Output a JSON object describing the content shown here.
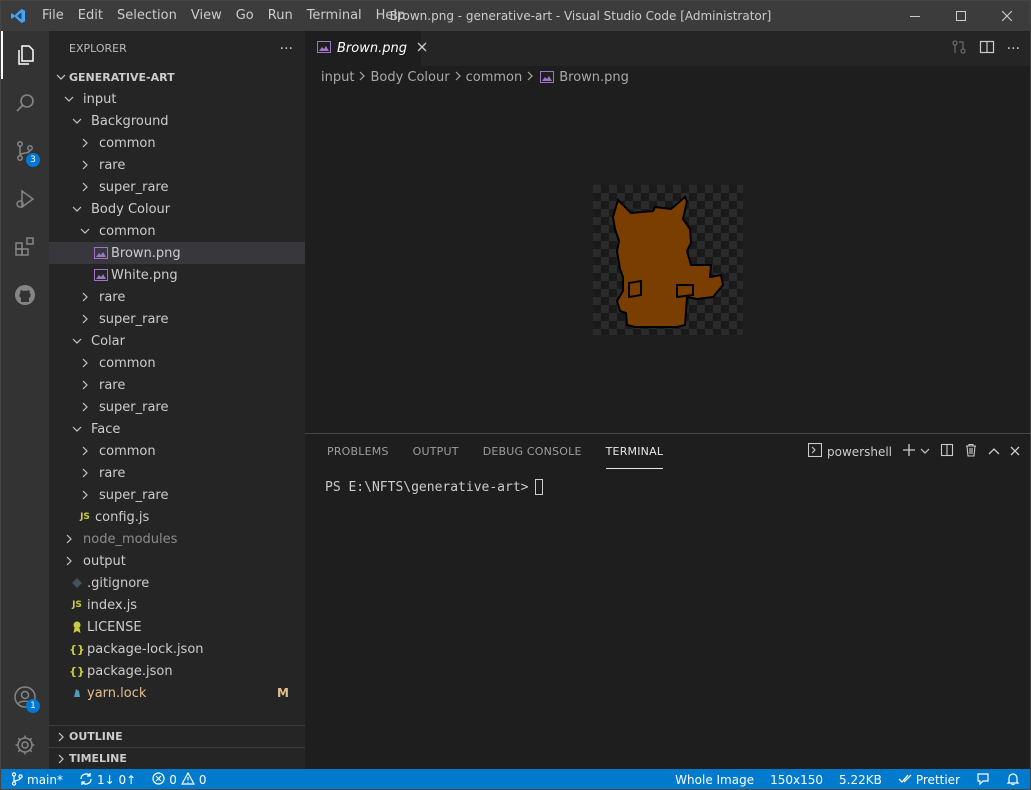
{
  "window": {
    "title": "Brown.png - generative-art - Visual Studio Code [Administrator]",
    "menu": [
      "File",
      "Edit",
      "Selection",
      "View",
      "Go",
      "Run",
      "Terminal",
      "Help"
    ]
  },
  "activity": {
    "scm_badge": "3",
    "accounts_badge": "1"
  },
  "explorer": {
    "header": "EXPLORER",
    "more": "···",
    "root": "GENERATIVE-ART",
    "items": [
      {
        "label": "input",
        "depth": 0,
        "kind": "folder-open"
      },
      {
        "label": "Background",
        "depth": 1,
        "kind": "folder-open"
      },
      {
        "label": "common",
        "depth": 2,
        "kind": "folder"
      },
      {
        "label": "rare",
        "depth": 2,
        "kind": "folder"
      },
      {
        "label": "super_rare",
        "depth": 2,
        "kind": "folder"
      },
      {
        "label": "Body Colour",
        "depth": 1,
        "kind": "folder-open"
      },
      {
        "label": "common",
        "depth": 2,
        "kind": "folder-open"
      },
      {
        "label": "Brown.png",
        "depth": 3,
        "kind": "image",
        "selected": true
      },
      {
        "label": "White.png",
        "depth": 3,
        "kind": "image"
      },
      {
        "label": "rare",
        "depth": 2,
        "kind": "folder"
      },
      {
        "label": "super_rare",
        "depth": 2,
        "kind": "folder"
      },
      {
        "label": "Colar",
        "depth": 1,
        "kind": "folder-open"
      },
      {
        "label": "common",
        "depth": 2,
        "kind": "folder"
      },
      {
        "label": "rare",
        "depth": 2,
        "kind": "folder"
      },
      {
        "label": "super_rare",
        "depth": 2,
        "kind": "folder"
      },
      {
        "label": "Face",
        "depth": 1,
        "kind": "folder-open"
      },
      {
        "label": "common",
        "depth": 2,
        "kind": "folder"
      },
      {
        "label": "rare",
        "depth": 2,
        "kind": "folder"
      },
      {
        "label": "super_rare",
        "depth": 2,
        "kind": "folder"
      },
      {
        "label": "config.js",
        "depth": 1,
        "kind": "js"
      },
      {
        "label": "node_modules",
        "depth": 0,
        "kind": "folder",
        "dim": true
      },
      {
        "label": "output",
        "depth": 0,
        "kind": "folder"
      },
      {
        "label": ".gitignore",
        "depth": 0,
        "kind": "git"
      },
      {
        "label": "index.js",
        "depth": 0,
        "kind": "js"
      },
      {
        "label": "LICENSE",
        "depth": 0,
        "kind": "license"
      },
      {
        "label": "package-lock.json",
        "depth": 0,
        "kind": "json"
      },
      {
        "label": "package.json",
        "depth": 0,
        "kind": "json"
      },
      {
        "label": "yarn.lock",
        "depth": 0,
        "kind": "yarn",
        "mod": "M"
      }
    ],
    "outline": "OUTLINE",
    "timeline": "TIMELINE"
  },
  "editor": {
    "tab": "Brown.png",
    "breadcrumb": [
      "input",
      "Body Colour",
      "common",
      "Brown.png"
    ],
    "image_color": "#7a3e00"
  },
  "panel": {
    "tabs": [
      "PROBLEMS",
      "OUTPUT",
      "DEBUG CONSOLE",
      "TERMINAL"
    ],
    "active_tab": "TERMINAL",
    "shell": "powershell",
    "prompt": "PS E:\\NFTS\\generative-art>"
  },
  "status": {
    "branch": "main*",
    "sync": "1↓ 0↑",
    "errors": "0",
    "warnings": "0",
    "mode": "Whole Image",
    "dimensions": "150x150",
    "size": "5.22KB",
    "prettier": "Prettier"
  },
  "colors": {
    "statusbar": "#007acc",
    "activity": "#333333",
    "sidebar": "#252526"
  }
}
